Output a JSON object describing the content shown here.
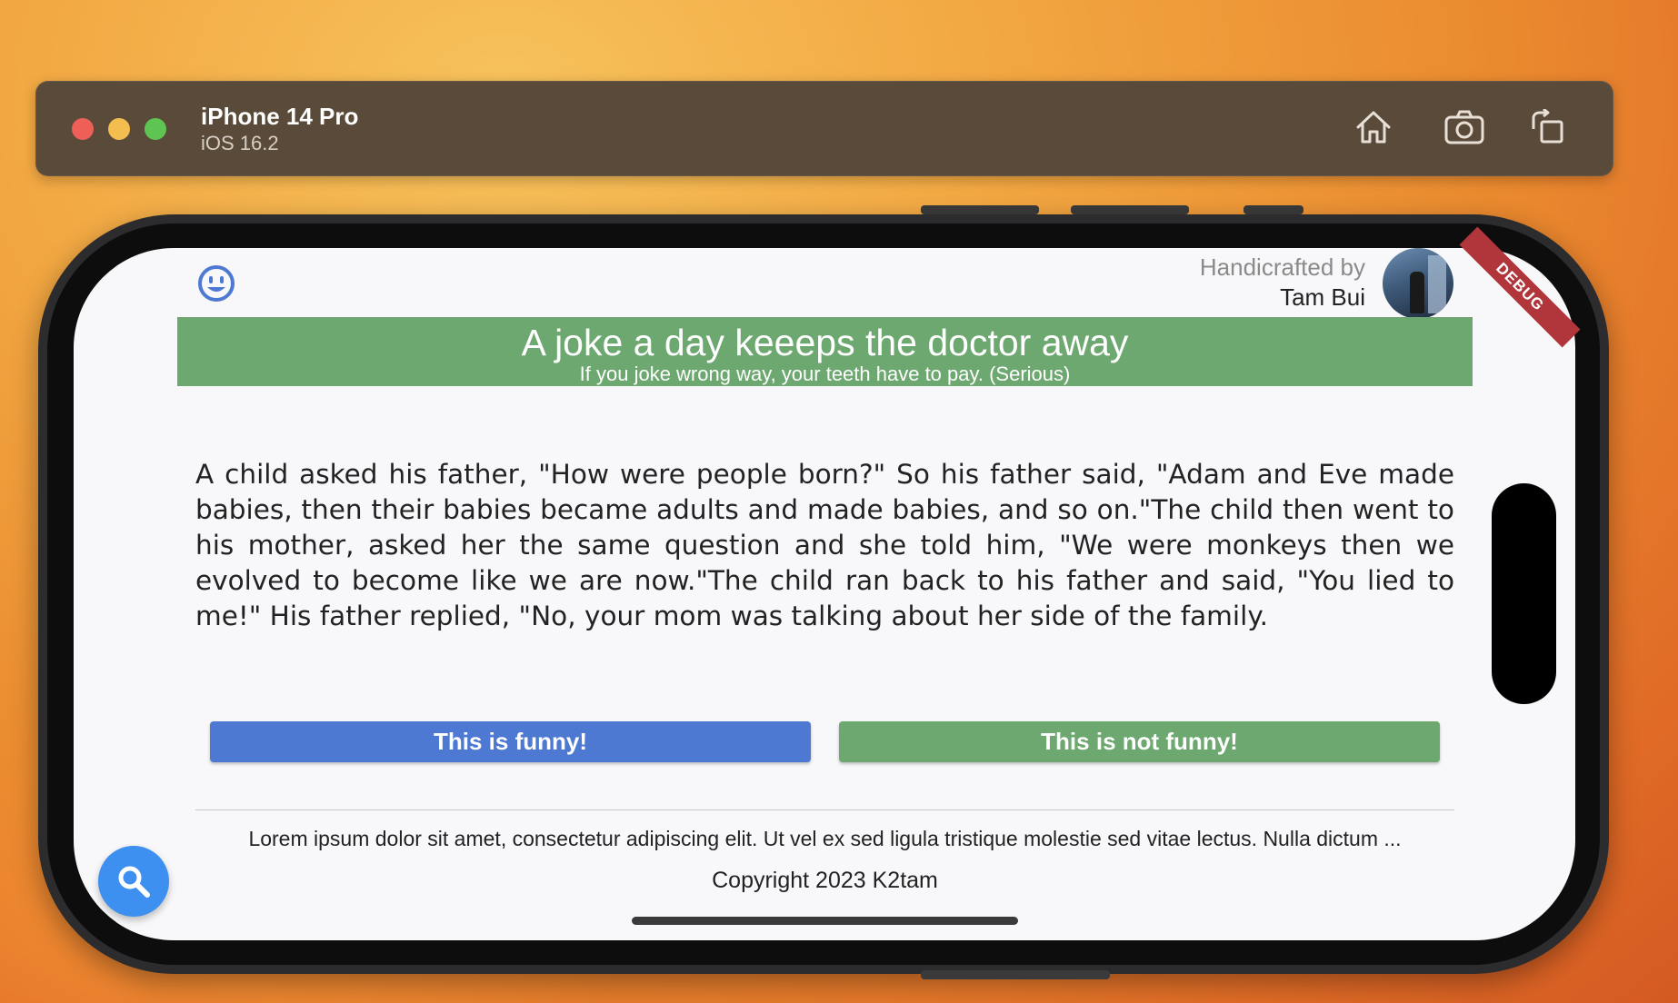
{
  "simulator": {
    "device_name": "iPhone 14 Pro",
    "os_version": "iOS 16.2",
    "buttons": [
      "home-icon",
      "screenshot-icon",
      "rotate-icon"
    ]
  },
  "app": {
    "debug_banner": "DEBUG",
    "header": {
      "icon": "smiley-icon",
      "credit_label": "Handicrafted by",
      "credit_name": "Tam Bui"
    },
    "banner": {
      "title": "A joke a day keeeps the doctor away",
      "subtitle": "If you joke wrong way, your teeth have to pay. (Serious)"
    },
    "joke_text": "A child asked his father, \"How were people born?\" So his father said, \"Adam and Eve made babies, then their babies became adults and made babies, and so on.\"The child then went to his mother, asked her the same question and she told him, \"We were monkeys then we evolved to become like we are now.\"The child ran back to his father and said, \"You lied to me!\" His father replied, \"No, your mom was talking about her side of the family.",
    "buttons": {
      "funny": "This is funny!",
      "not_funny": "This is not funny!"
    },
    "footer": {
      "lorem": "Lorem ipsum dolor sit amet, consectetur adipiscing elit. Ut vel ex sed ligula tristique molestie sed vitae lectus. Nulla dictum ...",
      "copyright": "Copyright 2023 K2tam"
    },
    "fab_icon": "search-icon"
  },
  "colors": {
    "banner_green": "#6ca86f",
    "funny_blue": "#4e79d3",
    "fab_blue": "#3d8ff0",
    "debug_red": "#b0363c"
  }
}
